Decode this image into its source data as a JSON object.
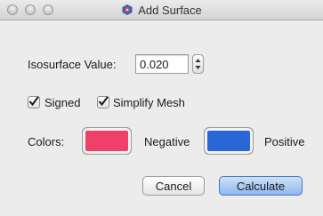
{
  "window": {
    "title": "Add Surface",
    "app_icon": "avogadro-molecule-icon",
    "controls": [
      "close-icon",
      "minimize-icon",
      "zoom-icon"
    ]
  },
  "form": {
    "isosurface_label": "Isosurface Value:",
    "isosurface_value": "0.020",
    "signed": {
      "label": "Signed",
      "checked": true
    },
    "simplify_mesh": {
      "label": "Simplify Mesh",
      "checked": true
    },
    "colors_label": "Colors:",
    "negative": {
      "label": "Negative",
      "color": "#f0406a"
    },
    "positive": {
      "label": "Positive",
      "color": "#2b66d6"
    }
  },
  "buttons": {
    "cancel": "Cancel",
    "calculate": "Calculate"
  }
}
